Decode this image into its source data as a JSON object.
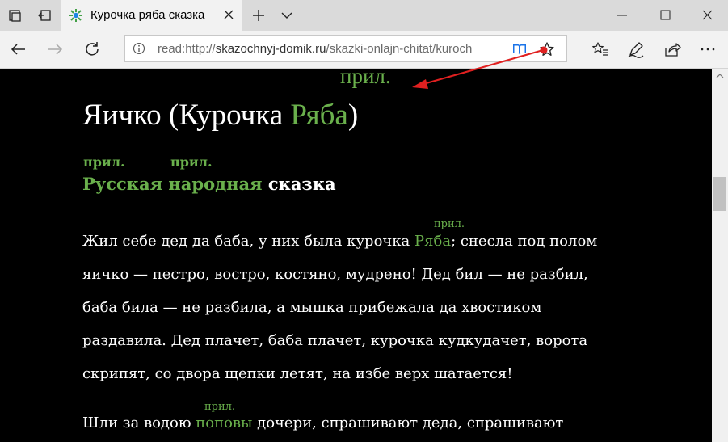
{
  "tab": {
    "title": "Курочка ряба сказка"
  },
  "address": {
    "url_prefix": "read:http://",
    "url_host": "skazochnyj-domik.ru",
    "url_rest": "/skazki-onlajn-chitat/kuroch"
  },
  "page": {
    "title_part1": "Яичко (Курочка ",
    "title_highlight": "Ряба",
    "title_part2": ")",
    "pril": "прил.",
    "subtitle_word1": "Русская",
    "subtitle_word2": "народная",
    "subtitle_word3": "сказка",
    "para1_line1_a": "Жил себе дед да баба, у них была курочка ",
    "para1_line1_hl": "Ряба",
    "para1_line1_b": "; снесла под полом",
    "para1_line2": "яичко — пестро, востро, костяно, мудрено! Дед бил — не разбил,",
    "para1_line3": "баба била — не разбила, а мышка прибежала да хвостиком",
    "para1_line4": "раздавила. Дед плачет, баба плачет, курочка кудкудачет, ворота",
    "para1_line5": "скрипят, со двора щепки летят, на избе верх шатается!",
    "para2_line1_a": "Шли за водою ",
    "para2_line1_hl": "поповы",
    "para2_line1_b": " дочери, спрашивают деда, спрашивают"
  },
  "colors": {
    "highlight": "#6ab04c",
    "arrow": "#e02020",
    "background": "#000000"
  }
}
